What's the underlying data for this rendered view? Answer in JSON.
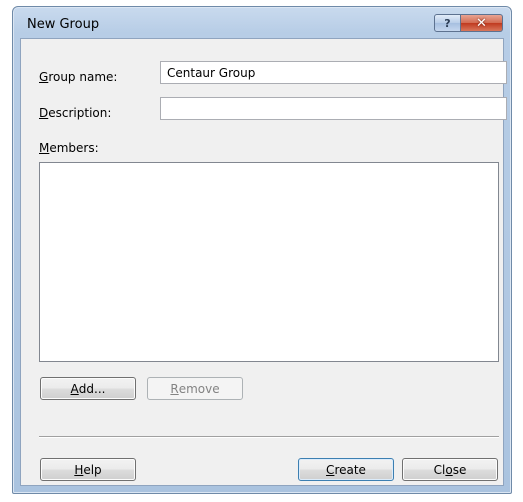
{
  "window": {
    "title": "New Group",
    "help_button": "?",
    "close_button": "✕"
  },
  "form": {
    "group_name_label_key": "G",
    "group_name_label_rest": "roup name:",
    "group_name_value": "Centaur Group",
    "description_label_key": "D",
    "description_label_rest": "escription:",
    "description_value": "",
    "members_label_key": "M",
    "members_label_rest": "embers:",
    "members": []
  },
  "buttons": {
    "add_key": "A",
    "add_rest": "dd...",
    "remove_key": "R",
    "remove_rest": "emove",
    "help_key": "H",
    "help_rest": "elp",
    "create_key": "C",
    "create_rest": "reate",
    "close_pre": "Cl",
    "close_key": "o",
    "close_rest": "se"
  }
}
